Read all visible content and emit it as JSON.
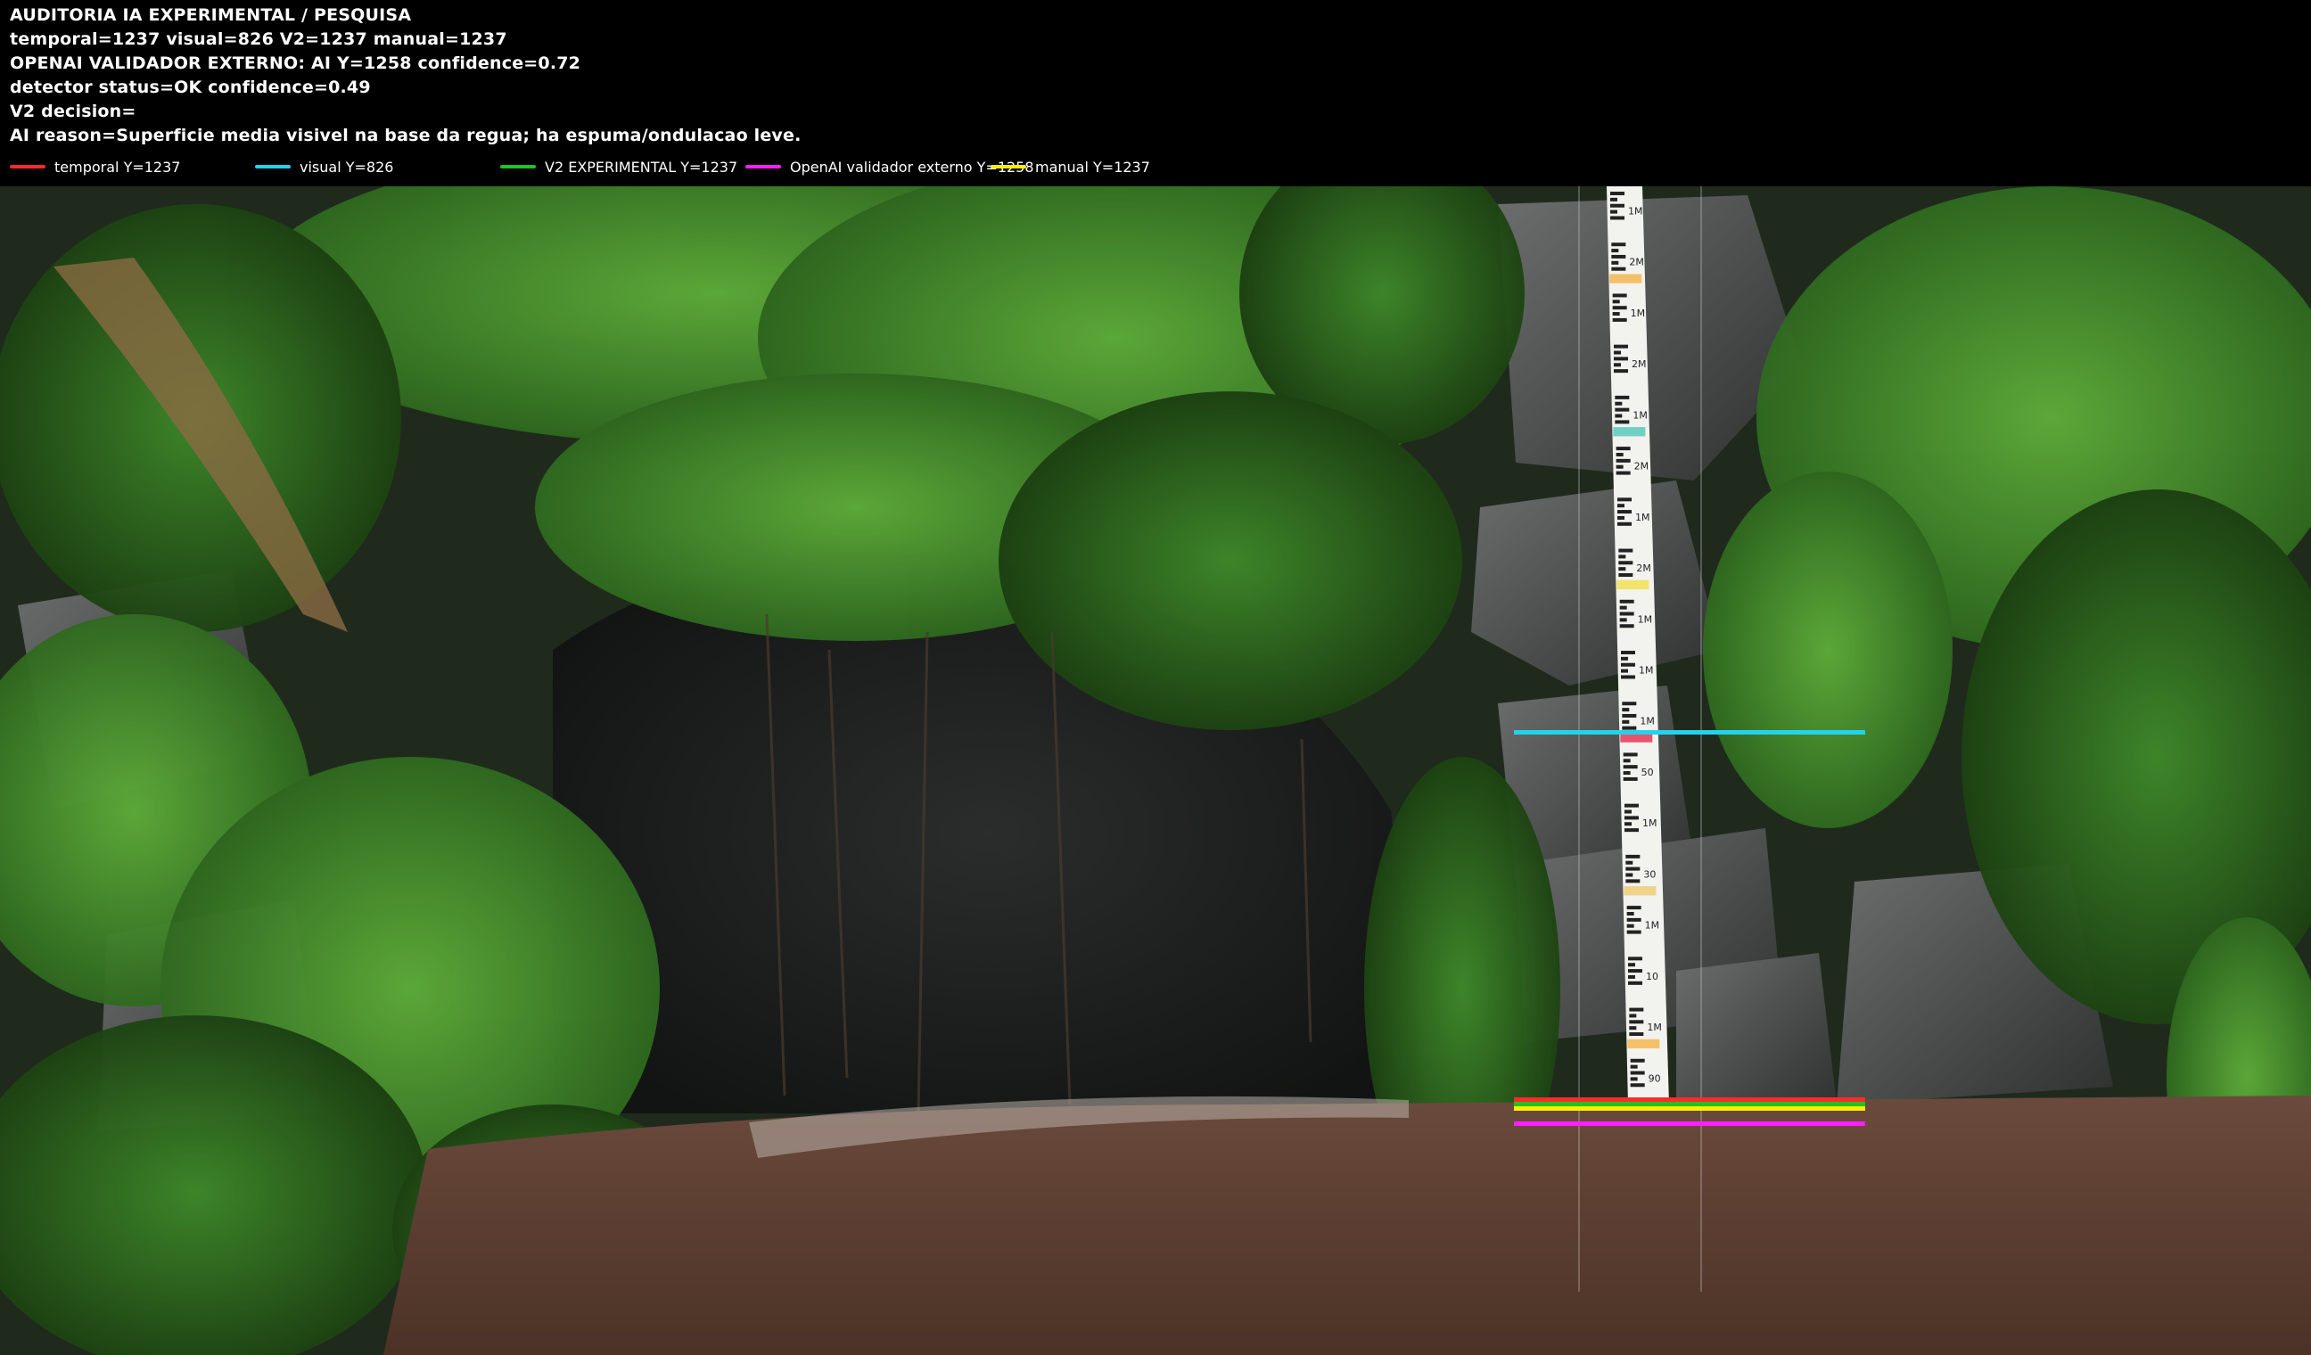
{
  "header": {
    "line1": "AUDITORIA IA  EXPERIMENTAL / PESQUISA",
    "line2": "temporal=1237  visual=826  V2=1237  manual=1237",
    "line3": "OPENAI  VALIDADOR EXTERNO: AI Y=1258  confidence=0.72",
    "line4": "detector status=OK confidence=0.49",
    "line5": "V2 decision=",
    "line6": "AI reason=Superficie media visivel na base da regua; ha espuma/ondulacao leve."
  },
  "legend": [
    {
      "label": "temporal Y=1237",
      "color": "#ff2a2a"
    },
    {
      "label": "visual Y=826",
      "color": "#22d3ee"
    },
    {
      "label": "V2 EXPERIMENTAL Y=1237",
      "color": "#22c21f"
    },
    {
      "label": "OpenAI validador externo Y=1258",
      "color": "#ff1fff"
    },
    {
      "label": "manual Y=1237",
      "color": "#ffee00"
    }
  ],
  "overlay_colors": {
    "visual": "#22d3ee",
    "temporal": "#ff2a2a",
    "v2": "#22c21f",
    "manual": "#ffee00",
    "openai": "#ff1fff"
  },
  "gauge": {
    "labels": [
      "1M",
      "2M",
      "1M",
      "2M",
      "1M",
      "2M",
      "1M",
      "2M",
      "1M",
      "1M",
      "1M",
      "50",
      "1M",
      "30",
      "1M",
      "10",
      "1M",
      "90"
    ]
  }
}
